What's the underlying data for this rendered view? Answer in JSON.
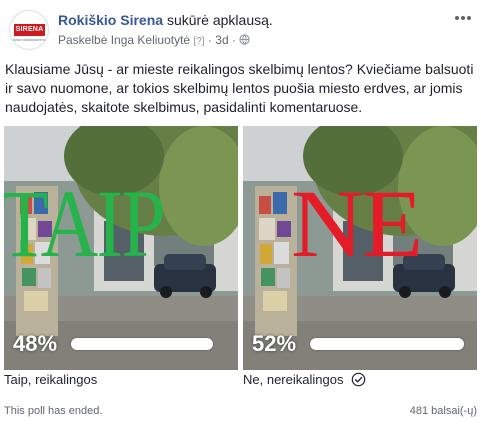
{
  "post": {
    "page_name": "Rokiškio Sirena",
    "action": "sukūrė apklausą.",
    "meta_prefix": "Paskelbė",
    "author": "Inga Keliuotytė",
    "author_badge": "[?]",
    "separator": "·",
    "age": "3d",
    "separator2": "·",
    "avatar_text": "SIRENA",
    "avatar_subtext": "www.rokiskiosirena.lt",
    "text": "Klausiame Jūsų - ar mieste reikalingos skelbimų lentos? Kviečiame balsuoti ir savo nuomone, ar tokios skelbimų lentos puošia miesto erdves, ar jomis naudojatės, skaitote skelbimus, pasidalinti komentaruose."
  },
  "poll": {
    "options": [
      {
        "image_text": "TAIP",
        "percent_label": "48%",
        "percent": 48,
        "label": "Taip, reikalingos",
        "selected": false
      },
      {
        "image_text": "NE",
        "percent_label": "52%",
        "percent": 52,
        "label": "Ne, nereikalingos",
        "selected": true
      }
    ],
    "status": "This poll has ended.",
    "votes": "481 balsai(-ų)"
  },
  "colors": {
    "page_link": "#365899",
    "taip_text": "#26b34a",
    "ne_text": "#e41c28",
    "secondary_text": "#616770"
  },
  "icons": [
    "globe-icon",
    "more-icon",
    "check-circle-icon"
  ]
}
